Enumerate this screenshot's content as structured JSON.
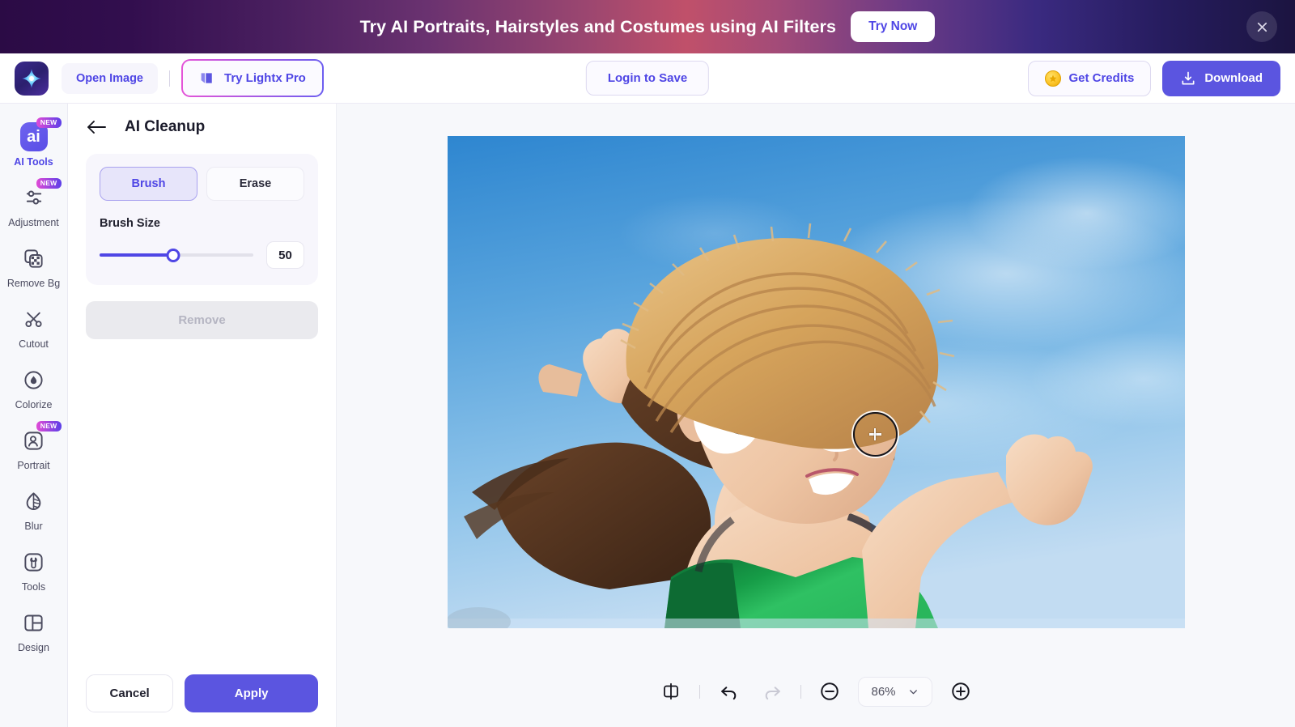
{
  "promo": {
    "text": "Try AI Portraits, Hairstyles and Costumes using AI Filters",
    "cta": "Try Now",
    "close_icon": "close-icon",
    "accent_white": "#ffffff",
    "cta_text_color": "#4f46e5"
  },
  "header": {
    "logo_icon": "lightx-logo-icon",
    "open_image": "Open Image",
    "pro_button": "Try Lightx Pro",
    "pro_icon": "pro-sparkle-icon",
    "login": "Login to Save",
    "credits": "Get Credits",
    "credits_icon": "coin-icon",
    "download": "Download",
    "download_icon": "download-icon",
    "primary_color": "#5b55e0"
  },
  "rail": {
    "items": [
      {
        "label": "AI Tools",
        "icon": "ai-tools-icon",
        "badge": "NEW",
        "active": true
      },
      {
        "label": "Adjustment",
        "icon": "sliders-icon",
        "badge": "NEW",
        "active": false
      },
      {
        "label": "Remove Bg",
        "icon": "remove-bg-icon",
        "badge": "",
        "active": false
      },
      {
        "label": "Cutout",
        "icon": "scissors-icon",
        "badge": "",
        "active": false
      },
      {
        "label": "Colorize",
        "icon": "droplet-icon",
        "badge": "",
        "active": false
      },
      {
        "label": "Portrait",
        "icon": "portrait-icon",
        "badge": "NEW",
        "active": false
      },
      {
        "label": "Blur",
        "icon": "blur-leaf-icon",
        "badge": "",
        "active": false
      },
      {
        "label": "Tools",
        "icon": "wrench-icon",
        "badge": "",
        "active": false
      },
      {
        "label": "Design",
        "icon": "layout-icon",
        "badge": "",
        "active": false
      }
    ]
  },
  "panel": {
    "back_icon": "back-arrow-icon",
    "title": "AI Cleanup",
    "modes": [
      {
        "label": "Brush",
        "selected": true
      },
      {
        "label": "Erase",
        "selected": false
      }
    ],
    "brush_size_label": "Brush Size",
    "brush_size_value": "50",
    "brush_size_min": 0,
    "brush_size_max": 100,
    "remove_label": "Remove",
    "remove_disabled": true,
    "cancel_label": "Cancel",
    "apply_label": "Apply"
  },
  "canvas": {
    "photo_alt": "Woman in straw hat and white sunglasses wearing a green tank top against a blue sky",
    "brush_cursor_icon": "brush-crosshair-cursor",
    "sky_top_color": "#3b8fd4",
    "sky_bottom_color": "#b9d9f2",
    "hat_color": "#d9a85f",
    "top_color": "#2fb45c"
  },
  "toolbar": {
    "compare_icon": "compare-split-icon",
    "undo_icon": "undo-icon",
    "redo_icon": "redo-icon",
    "redo_disabled": true,
    "zoom_out_icon": "zoom-out-icon",
    "zoom_level": "86%",
    "zoom_chevron_icon": "chevron-down-icon",
    "zoom_in_icon": "zoom-in-icon"
  }
}
